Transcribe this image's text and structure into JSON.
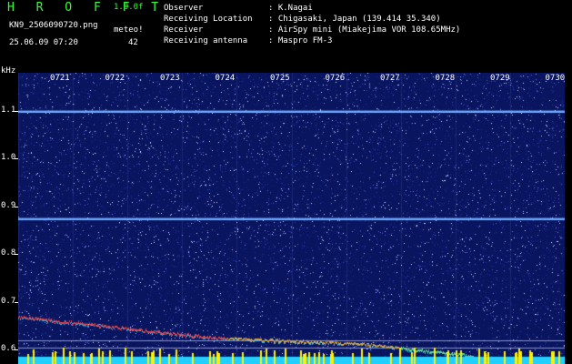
{
  "header": {
    "title": "H R O F F T",
    "version": "1.0.0f",
    "filename": "KN9_2506090720.png",
    "datetime": "25.06.09 07:20",
    "meteor_label": "meteo!",
    "meteor_count": "42"
  },
  "info": [
    {
      "key": "Observer",
      "value": ": K.Nagai"
    },
    {
      "key": "Receiving Location",
      "value": ": Chigasaki, Japan (139.414 35.340)"
    },
    {
      "key": "Receiver",
      "value": ": AirSpy mini (Miakejima VOR 108.65MHz)"
    },
    {
      "key": "Receiving antenna",
      "value": ": Maspro FM-3"
    }
  ],
  "axis": {
    "unit": "kHz",
    "minutes": [
      "0721",
      "0722",
      "0723",
      "0724",
      "0725",
      "0726",
      "0727",
      "0728",
      "0729",
      "0730"
    ],
    "y_ticks": [
      "1.1",
      "1.0",
      "0.9",
      "0.8",
      "0.7",
      "0.6"
    ],
    "y_range_khz": [
      0.57,
      1.18
    ],
    "x_range_minutes": [
      0,
      10
    ]
  },
  "signals": {
    "carriers_khz": [
      1.1,
      0.875,
      0.62,
      0.605
    ],
    "trace_color": "#e04040"
  },
  "colors": {
    "background": "#0a1560",
    "header_accent": "#33ff33",
    "carrier": "#66aaff",
    "bottom_band": "#22d0ff",
    "markers": "#ffee00"
  }
}
